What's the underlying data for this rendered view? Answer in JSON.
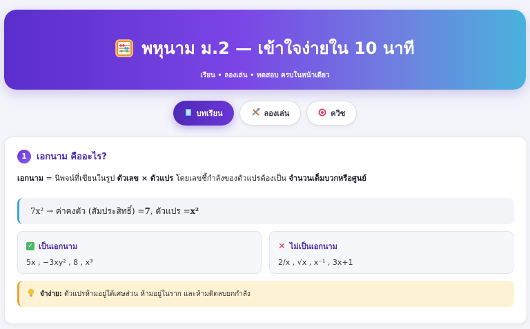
{
  "header": {
    "title": "พหุนาม ม.2 — เข้าใจง่ายใน 10 นาที",
    "subtitle": "เรียน • ลองเล่น • ทดสอบ ครบในหน้าเดียว",
    "icon": "abacus-icon"
  },
  "tabs": [
    {
      "label": "บทเรียน",
      "icon": "book-icon",
      "active": true
    },
    {
      "label": "ลองเล่น",
      "icon": "tools-icon",
      "active": false
    },
    {
      "label": "ควิซ",
      "icon": "target-icon",
      "active": false
    }
  ],
  "section": {
    "number": "1",
    "title": "เอกนาม คืออะไร?",
    "definition": {
      "term": "เอกนาม",
      "eq": " = นิพจน์ที่เขียนในรูป ",
      "form": "ตัวเลข × ตัวแปร",
      "mid": " โดยเลขชี้กำลังของตัวแปรต้องเป็น ",
      "cond": "จำนวนเต็มบวกหรือศูนย์"
    },
    "example": {
      "prefix": "7x² → ค่าคงตัว (สัมประสิทธิ์) = ",
      "coef": "7",
      "mid": " , ตัวแปร = ",
      "var": "x²"
    },
    "is_monomial": {
      "title": "เป็นเอกนาม",
      "values": "5x , −3xy² , 8 , x³"
    },
    "not_monomial": {
      "title": "ไม่เป็นเอกนาม",
      "values": "2/x , √x , x⁻¹ , 3x+1"
    },
    "tip": {
      "label": "จำง่าย:",
      "text": "ตัวแปรห้ามอยู่ใต้เศษส่วน ห้ามอยู่ในราก และห้ามติดลบยกกำลัง"
    }
  },
  "colors": {
    "accent": "#5b2ecb",
    "hero_end": "#49b2dc",
    "success": "#4cb86a",
    "danger": "#e0456a",
    "tip_bg": "#fdf3d4"
  }
}
